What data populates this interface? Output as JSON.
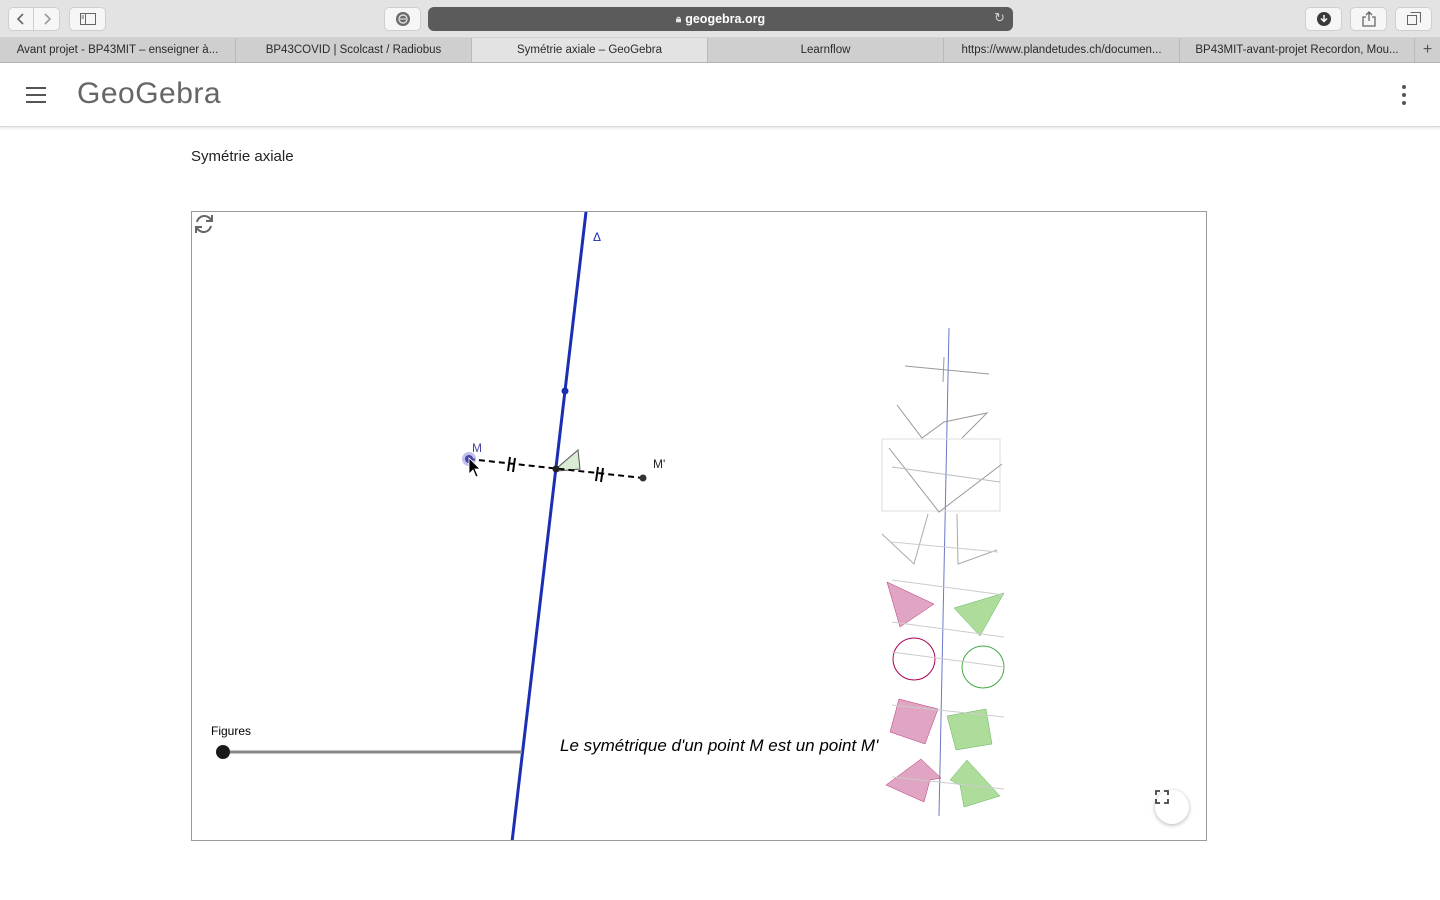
{
  "browser": {
    "address": "geogebra.org",
    "tabs": [
      {
        "label": "Avant projet - BP43MIT – enseigner à..."
      },
      {
        "label": "BP43COVID | Scolcast / Radiobus"
      },
      {
        "label": "Symétrie axiale – GeoGebra"
      },
      {
        "label": "Learnflow"
      },
      {
        "label": "https://www.plandetudes.ch/documen..."
      },
      {
        "label": "BP43MIT-avant-projet Recordon, Mou..."
      }
    ],
    "icons": {
      "back": "chevron-left-icon",
      "forward": "chevron-right-icon",
      "sidebar": "sidebar-icon",
      "privacy": "privacy-report-icon",
      "reload": "reload-icon",
      "download": "download-icon",
      "share": "share-icon",
      "tabs": "tab-overview-icon",
      "new_tab": "plus-icon"
    }
  },
  "app": {
    "logo": "GeoGebra",
    "page_title": "Symétrie axiale"
  },
  "applet": {
    "axis_label": "Δ",
    "point_label": "M",
    "image_label": "M'",
    "slider_label": "Figures",
    "caption": "Le symétrique d'un point M  est un point M'",
    "colors": {
      "axis": "#1a2fb3",
      "point_highlight": "#8c8cd9",
      "right_angle_fill": "#d9ecd4",
      "pink_figure": "#d98fb3",
      "green_figure": "#9fd68a"
    }
  }
}
